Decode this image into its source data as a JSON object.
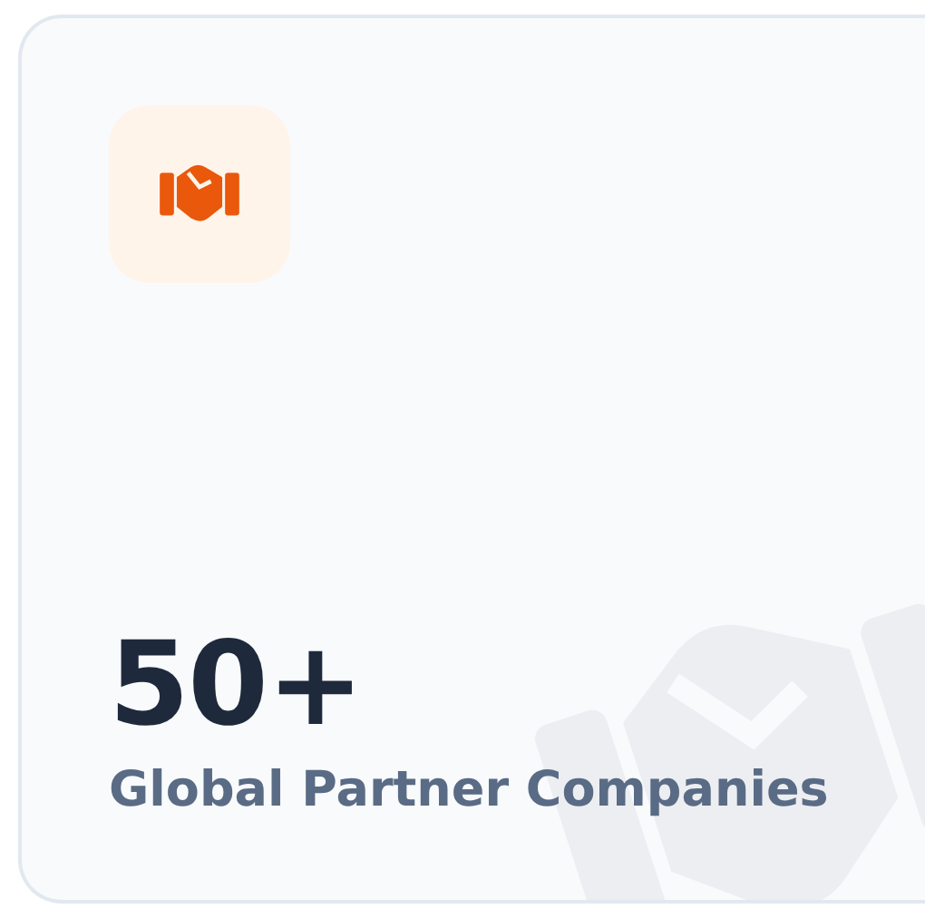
{
  "stat_card": {
    "value": "50+",
    "label": "Global Partner Companies"
  }
}
